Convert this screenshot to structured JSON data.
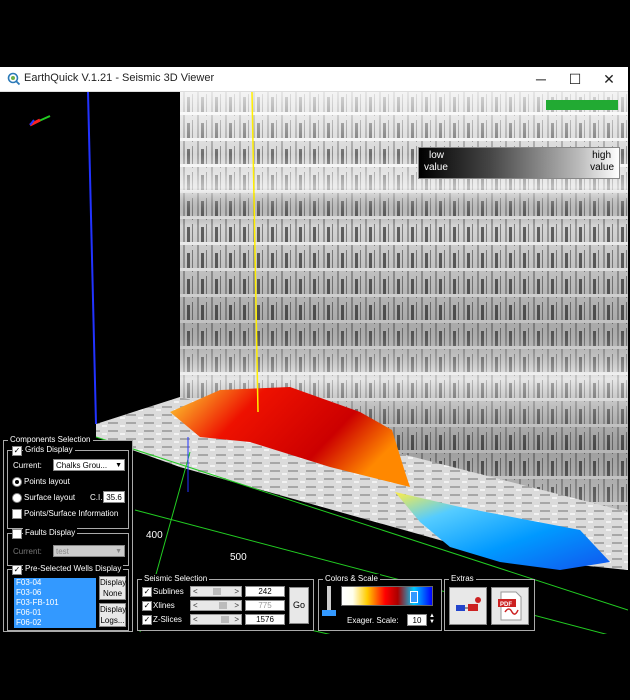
{
  "window": {
    "title": "EarthQuick V.1.21 - Seismic 3D Viewer",
    "minimize_glyph": "─",
    "maximize_glyph": "☐",
    "close_glyph": "✕"
  },
  "legend": {
    "low_line1": "low",
    "low_line2": "value",
    "high_line1": "high",
    "high_line2": "value"
  },
  "axis_labels": [
    "400",
    "500"
  ],
  "components": {
    "title": "Components Selection",
    "grids": {
      "label": "Grids Display",
      "checked": true,
      "current_label": "Current:",
      "current_value": "Chalks Grou...",
      "points_layout": "Points layout",
      "surface_layout": "Surface layout",
      "ci_label": "C.I.",
      "ci_value": "35.6",
      "info_label": "Points/Surface Information"
    },
    "faults": {
      "label": "Faults Display",
      "checked": false,
      "current_label": "Current:",
      "current_value": "test"
    },
    "wells": {
      "label": "Pre-Selected Wells Display",
      "checked": true,
      "items": [
        "F03-04",
        "F03-06",
        "F03-FB-101",
        "F06-01",
        "F06-02"
      ],
      "display_none": [
        "Display",
        "None"
      ],
      "display_logs": [
        "Display",
        "Logs..."
      ]
    }
  },
  "seismic": {
    "title": "Seismic Selection",
    "sublines": {
      "label": "Sublines",
      "value": "242",
      "checked": true
    },
    "xlines": {
      "label": "Xlines",
      "value": "775",
      "checked": true
    },
    "zslices": {
      "label": "Z-Slices",
      "value": "1576",
      "checked": true
    },
    "go": "Go",
    "left_arrow": "<",
    "right_arrow": ">"
  },
  "colors": {
    "title": "Colors & Scale",
    "exag_label": "Exager. Scale:",
    "exag_value": "10"
  },
  "extras": {
    "title": "Extras"
  },
  "icons": [
    "app-logo-icon",
    "axis-gizmo-icon",
    "wells-tool-icon",
    "pdf-icon",
    "chevron-down-icon",
    "spin-arrows-icon"
  ],
  "colors_hex": {
    "indicator": "#22aa33",
    "selection": "#3399ff",
    "axis_x": "#22cc22",
    "axis_y": "#ffee00",
    "axis_z": "#2233ff"
  }
}
